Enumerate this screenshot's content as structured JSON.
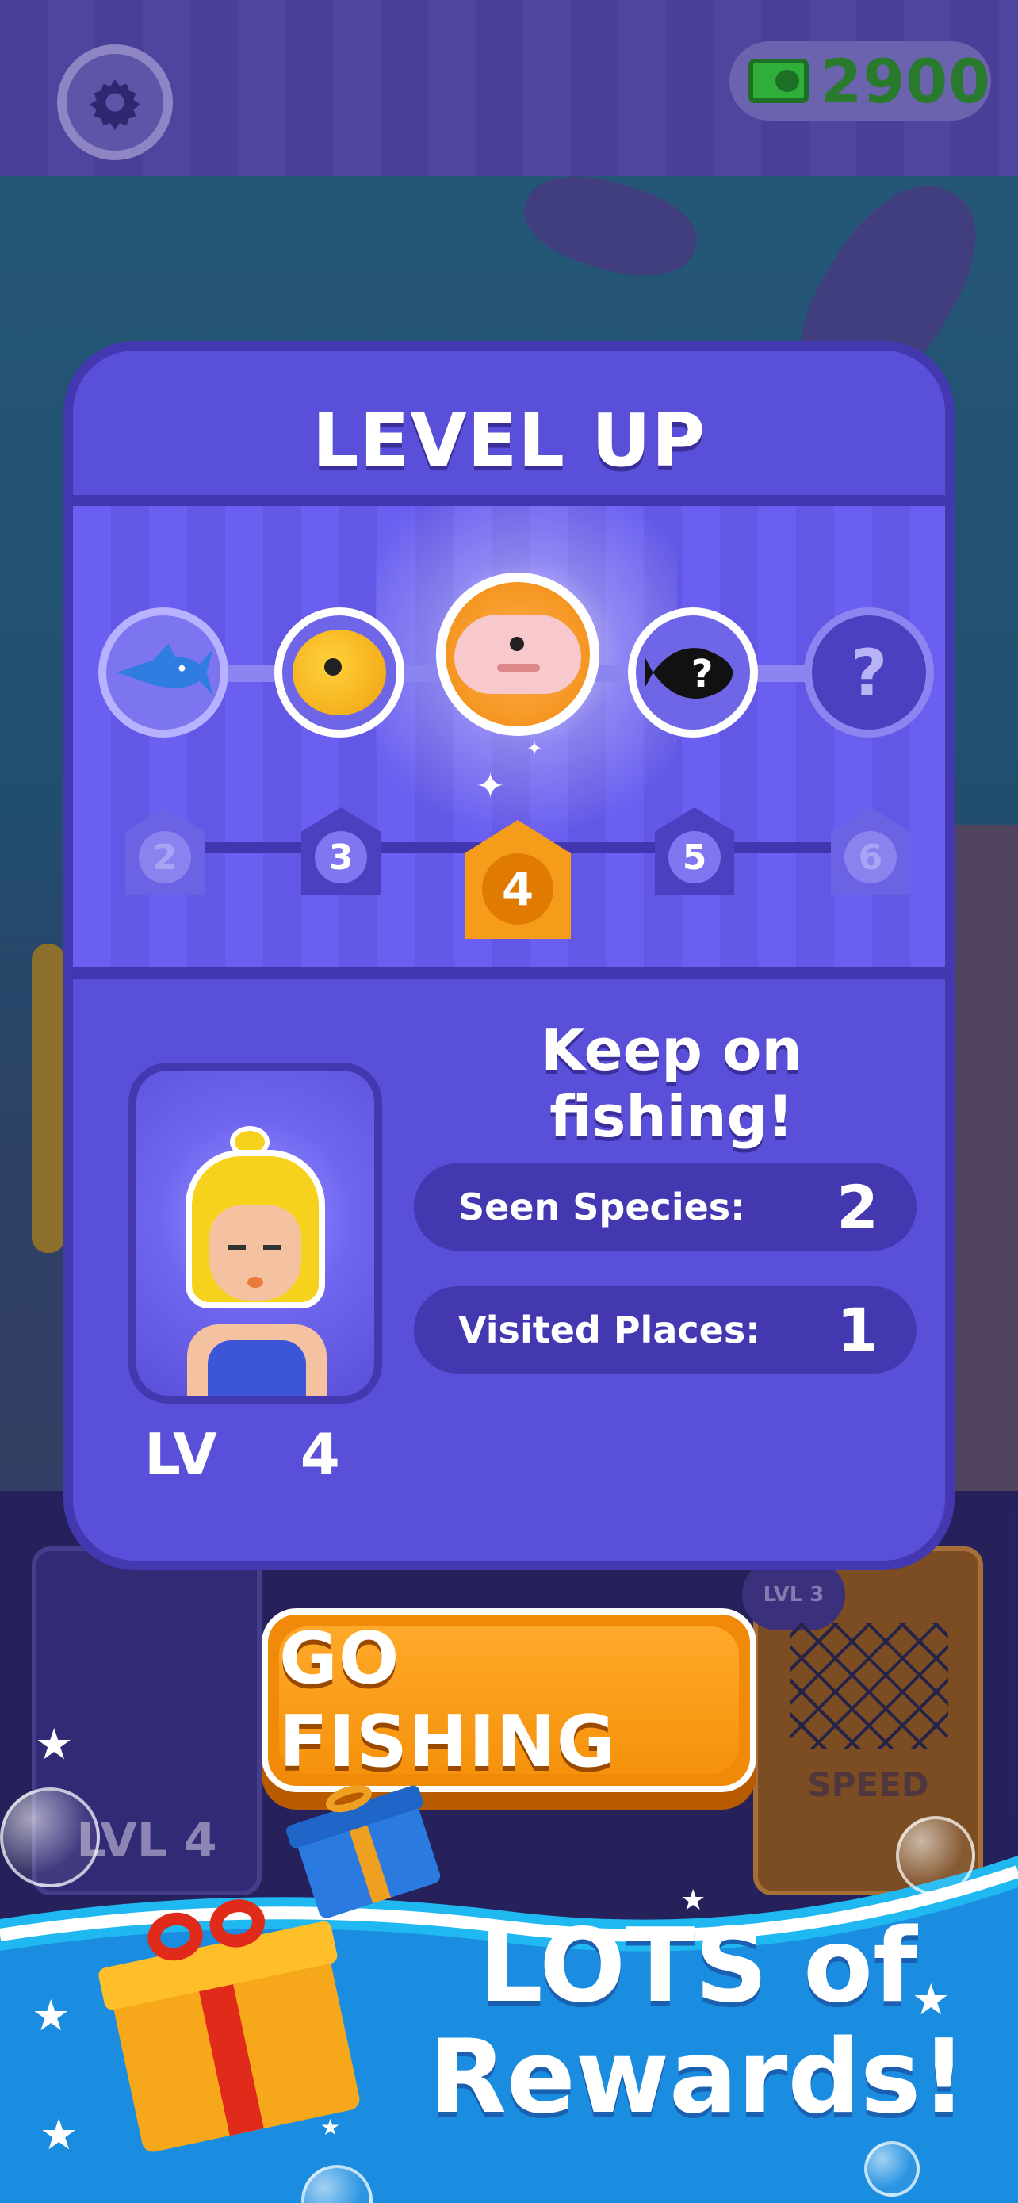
{
  "hud": {
    "cash_icon": "cash-icon",
    "cash_amount": "2900",
    "settings_icon": "gear-icon"
  },
  "modal": {
    "title": "LEVEL UP",
    "fish_unlocks": [
      {
        "name": "blue-swordfish-icon",
        "state": "unlocked"
      },
      {
        "name": "pufferfish-icon",
        "state": "unlocked"
      },
      {
        "name": "blobfish-icon",
        "state": "current"
      },
      {
        "name": "silhouette-fish-icon",
        "state": "next"
      },
      {
        "name": "unknown-fish-icon",
        "state": "locked",
        "label": "?"
      }
    ],
    "levels": [
      "2",
      "3",
      "4",
      "5",
      "6"
    ],
    "current_level_index": 2,
    "message": "Keep on fishing!",
    "stats": [
      {
        "label": "Seen Species:",
        "value": "2"
      },
      {
        "label": "Visited Places:",
        "value": "1"
      }
    ],
    "player_level_label": "LV",
    "player_level_value": "4"
  },
  "actions": {
    "go_fishing_label": "GO FISHING"
  },
  "background_panel": {
    "avatar_level": "LVL 4",
    "upgrade_tag": "LVL 3",
    "speed_label": "SPEED"
  },
  "promo": {
    "line1": "LOTS of",
    "line2": "Rewards!"
  },
  "colors": {
    "modal_bg": "#5a4fd8",
    "accent_orange": "#f59c1a",
    "cash_green": "#2a7a2e"
  }
}
